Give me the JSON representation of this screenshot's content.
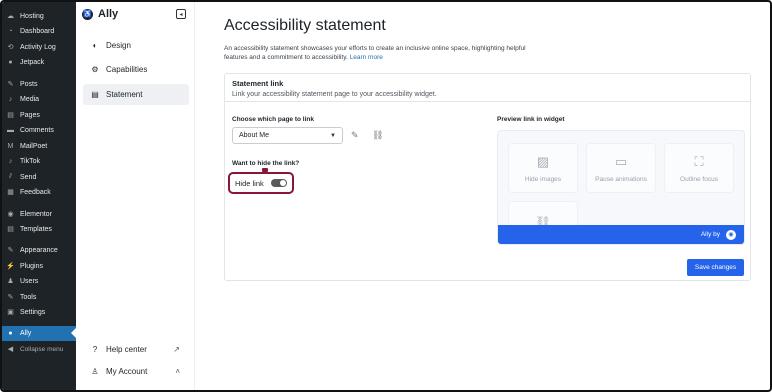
{
  "wp_menu": [
    {
      "label": "Hosting",
      "icon": "cloud-icon",
      "glyph": "☁"
    },
    {
      "label": "Dashboard",
      "icon": "dashboard-icon",
      "glyph": "◔"
    },
    {
      "label": "Activity Log",
      "icon": "clock-icon",
      "glyph": "⟲"
    },
    {
      "label": "Jetpack",
      "icon": "jetpack-icon",
      "glyph": "●"
    },
    {
      "label": "Posts",
      "icon": "pin-icon",
      "glyph": "✎"
    },
    {
      "label": "Media",
      "icon": "media-icon",
      "glyph": "♪"
    },
    {
      "label": "Pages",
      "icon": "page-icon",
      "glyph": "▤"
    },
    {
      "label": "Comments",
      "icon": "comment-icon",
      "glyph": "▬"
    },
    {
      "label": "MailPoet",
      "icon": "mailpoet-icon",
      "glyph": "M"
    },
    {
      "label": "TikTok",
      "icon": "tiktok-icon",
      "glyph": "♪"
    },
    {
      "label": "Send",
      "icon": "send-icon",
      "glyph": "⫽"
    },
    {
      "label": "Feedback",
      "icon": "feedback-icon",
      "glyph": "▦"
    },
    {
      "label": "Elementor",
      "icon": "elementor-icon",
      "glyph": "◉"
    },
    {
      "label": "Templates",
      "icon": "templates-icon",
      "glyph": "▤"
    },
    {
      "label": "Appearance",
      "icon": "brush-icon",
      "glyph": "✎"
    },
    {
      "label": "Plugins",
      "icon": "plugin-icon",
      "glyph": "⚡"
    },
    {
      "label": "Users",
      "icon": "user-icon",
      "glyph": "♟"
    },
    {
      "label": "Tools",
      "icon": "wrench-icon",
      "glyph": "✎"
    },
    {
      "label": "Settings",
      "icon": "settings-icon",
      "glyph": "▣"
    },
    {
      "label": "Ally",
      "icon": "ally-icon",
      "glyph": "●"
    },
    {
      "label": "Collapse menu",
      "icon": "collapse-icon",
      "glyph": "◀"
    }
  ],
  "ally": {
    "title": "Ally",
    "nav": [
      {
        "label": "Design",
        "icon": "palette-icon",
        "glyph": "◐"
      },
      {
        "label": "Capabilities",
        "icon": "gear-icon",
        "glyph": "⚙"
      },
      {
        "label": "Statement",
        "icon": "document-icon",
        "glyph": "▤"
      }
    ],
    "help_center": "Help center",
    "my_account": "My Account"
  },
  "main": {
    "title": "Accessibility statement",
    "intro": "An accessibility statement showcases your efforts to create an inclusive online space, highlighting helpful features and a commitment to accessibility.",
    "learn_more": "Learn more",
    "card_title": "Statement link",
    "card_subtitle": "Link your accessibility statement page to your accessibility widget.",
    "choose_label": "Choose which page to link",
    "selected_page": "About Me",
    "hide_question": "Want to hide the link?",
    "hide_label": "Hide link",
    "hide_link_enabled": true,
    "preview_label": "Preview link in widget",
    "tiles": [
      "Hide images",
      "Pause animations",
      "Outline focus"
    ],
    "widget_label": "Ally by",
    "save_label": "Save changes"
  }
}
